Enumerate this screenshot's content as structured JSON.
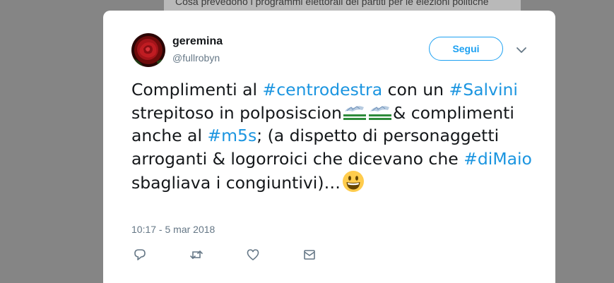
{
  "background": {
    "headline": "Cosa prevedono i programmi elettorali dei partiti per le elezioni politiche"
  },
  "tweet": {
    "display_name": "geremina",
    "handle": "@fullrobyn",
    "follow_label": "Segui",
    "segments": {
      "s1": "Complimenti al ",
      "h1": "#centrodestra",
      "s2": " con un ",
      "h2": "#Salvini",
      "s3": " strepitoso in polposiscion",
      "s4": "& complimenti anche al ",
      "h3": "#m5s",
      "s5": "; (a dispetto di personaggetti arroganti & logorroici che dicevano che ",
      "h4": "#diMaio",
      "s6": " sbagliava i congiuntivi)…"
    },
    "timestamp": "10:17 - 5 mar 2018"
  },
  "icons": {
    "avatar": "red-rose-avatar",
    "flags": "italian-flag-emoji",
    "smiley": "grinning-face-emoji",
    "caret": "chevron-down-icon",
    "actions": [
      "reply-icon",
      "retweet-icon",
      "like-icon",
      "direct-message-icon"
    ]
  },
  "colors": {
    "accent": "#1da1f2",
    "hashtag": "#1b95e0",
    "text": "#14171a",
    "muted": "#657786",
    "overlay": "#858585"
  }
}
